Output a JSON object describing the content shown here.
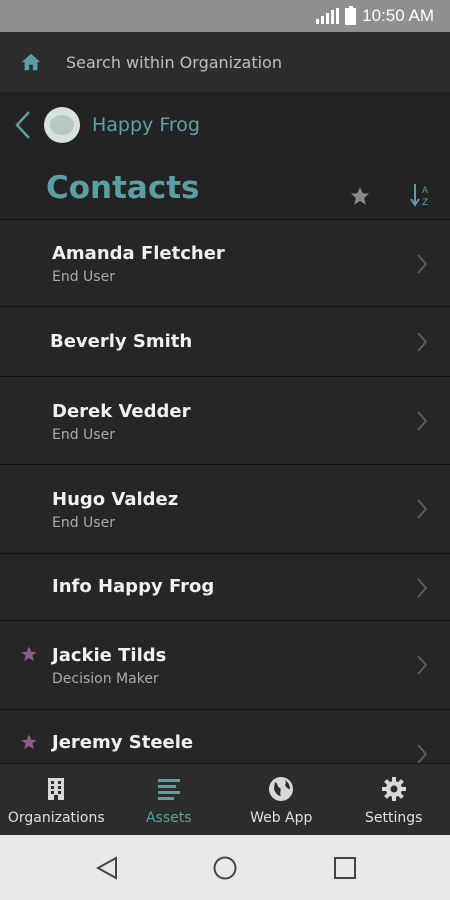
{
  "status_bar": {
    "time": "10:50 AM"
  },
  "search": {
    "placeholder": "Search within Organization"
  },
  "organization": {
    "name": "Happy Frog"
  },
  "page": {
    "title": "Contacts"
  },
  "contacts": [
    {
      "name": "Amanda Fletcher",
      "role": "End User",
      "favorite": false
    },
    {
      "name": "Beverly Smith",
      "role": "",
      "favorite": false
    },
    {
      "name": "Derek Vedder",
      "role": "End User",
      "favorite": false
    },
    {
      "name": "Hugo Valdez",
      "role": "End User",
      "favorite": false
    },
    {
      "name": "Info Happy Frog",
      "role": "",
      "favorite": false
    },
    {
      "name": "Jackie Tilds",
      "role": "Decision Maker",
      "favorite": true
    },
    {
      "name": "Jeremy Steele",
      "role": "",
      "favorite": true
    }
  ],
  "bottom_nav": {
    "items": [
      {
        "label": "Organizations",
        "icon": "building-icon",
        "active": false
      },
      {
        "label": "Assets",
        "icon": "list-icon",
        "active": true
      },
      {
        "label": "Web App",
        "icon": "globe-icon",
        "active": false
      },
      {
        "label": "Settings",
        "icon": "gear-icon",
        "active": false
      }
    ]
  },
  "colors": {
    "accent": "#5a9fa4",
    "favorite_star": "#8e5a8e",
    "background": "#232323"
  }
}
